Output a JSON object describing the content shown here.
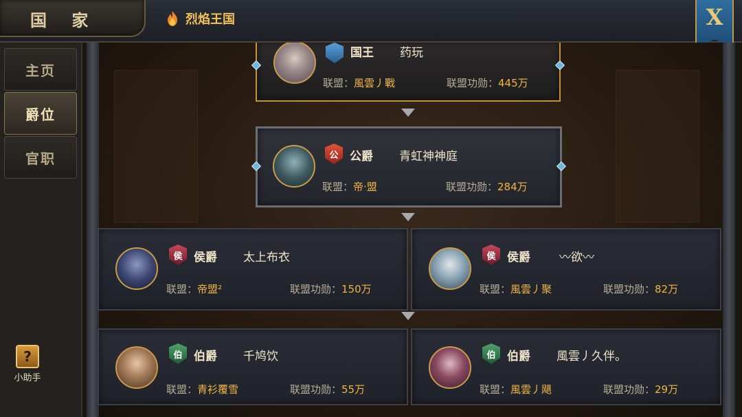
{
  "header": {
    "title": "国 家",
    "kingdom_name": "烈焰王国",
    "close_label": "X"
  },
  "sidebar": {
    "items": [
      {
        "label": "主页",
        "active": false
      },
      {
        "label": "爵位",
        "active": true
      },
      {
        "label": "官职",
        "active": false
      }
    ],
    "helper_label": "小助手",
    "helper_icon": "?"
  },
  "labels": {
    "alliance": "联盟：",
    "merit": "联盟功勋："
  },
  "nobles": {
    "king": {
      "rank": "国王",
      "name": "药玩",
      "alliance": "風雲丿戰",
      "merit": "445万",
      "badge": "",
      "badge_color": "#3a7fb5"
    },
    "duke": {
      "rank": "公爵",
      "name": "青虹神神庭",
      "alliance": "帝·盟",
      "merit": "284万",
      "badge": "公",
      "badge_color": "#c8342a"
    },
    "marquis": [
      {
        "rank": "侯爵",
        "name": "太上布衣",
        "alliance": "帝盟²",
        "merit": "150万",
        "badge": "侯",
        "badge_color": "#9a2e3a"
      },
      {
        "rank": "侯爵",
        "name": "〰欲〰",
        "alliance": "風雲丿聚",
        "merit": "82万",
        "badge": "侯",
        "badge_color": "#9a2e3a"
      }
    ],
    "earl": [
      {
        "rank": "伯爵",
        "name": "千鸠饮",
        "alliance": "青衫覆雪",
        "merit": "55万",
        "badge": "伯",
        "badge_color": "#2f7a4a"
      },
      {
        "rank": "伯爵",
        "name": "風雲丿久伴。",
        "alliance": "風雲丿飓",
        "merit": "29万",
        "badge": "伯",
        "badge_color": "#2f7a4a"
      }
    ]
  },
  "colors": {
    "accent_gold": "#f2b443",
    "text_light": "#f0e4c8",
    "card_border_king": "#c8902e"
  }
}
